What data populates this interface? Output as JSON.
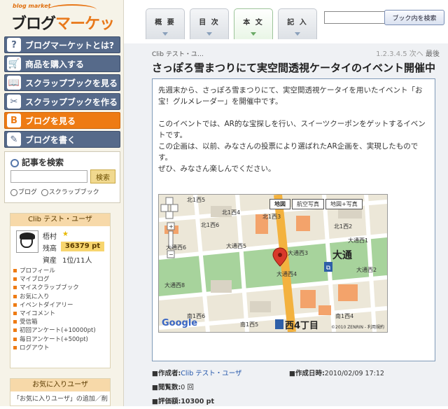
{
  "logo": {
    "tagline": "blog market",
    "name_a": "ブログ",
    "name_b": "マーケット"
  },
  "nav": [
    {
      "label": "ブログマーケットとは?",
      "icon": "question-icon"
    },
    {
      "label": "商品を購入する",
      "icon": "cart-icon"
    },
    {
      "label": "スクラップブックを見る",
      "icon": "book-icon"
    },
    {
      "label": "スクラップブックを作る",
      "icon": "scissors-icon"
    },
    {
      "label": "ブログを見る",
      "icon": "blog-icon"
    },
    {
      "label": "ブログを書く",
      "icon": "pen-icon"
    }
  ],
  "search": {
    "title": "記事を検索",
    "button": "検索",
    "option_blog": "ブログ",
    "option_scrap": "スクラップブック"
  },
  "user": {
    "header": "Clib テスト・ユーザ",
    "name": "梧村",
    "balance_label": "残高",
    "balance": "36379 pt",
    "asset_label": "資産",
    "asset": "1位/11人",
    "links": [
      "プロフィール",
      "マイブログ",
      "マイスクラップブック",
      "お気に入り",
      "イベントダイアリー",
      "マイコメント",
      "受信箱",
      "初回アンケート(+10000pt)",
      "毎日アンケート(+500pt)",
      "ログアウト"
    ]
  },
  "favorites": {
    "header": "お気に入りユーザ",
    "text": "「お気に入りユーザ」の追加／削"
  },
  "tabs": [
    {
      "label": "概 要"
    },
    {
      "label": "目 次"
    },
    {
      "label": "本 文"
    },
    {
      "label": "記 入"
    }
  ],
  "book_search": {
    "placeholder": "",
    "button": "ブック内を検索"
  },
  "article": {
    "breadcrumb": "Clib テスト・ユ…",
    "pager": "1.2.3.4.5 次へ",
    "pager_last": "最後",
    "title": "さっぽろ雪まつりにて実空間透視ケータイのイベント開催中",
    "paragraphs": [
      "先週末から、さっぽろ雪まつりにて、実空間透視ケータイを用いたイベント「お宝！グルメレーダー」を開催中です。",
      "",
      "このイベントでは、AR的な宝探しを行い、スイーツクーポンをゲットするイベントです。",
      "この企画は、以前、みなさんの投票により選ばれたAR企画を、実現したものです。",
      "ぜひ、みなさん楽しんでください。"
    ]
  },
  "map": {
    "btn_map": "地図",
    "btn_aerial": "航空写真",
    "btn_hybrid": "地図+写真",
    "google": "Google",
    "big_label_1": "大通",
    "big_label_2": "西4丁目",
    "copyright": "©2010 ZENRIN - 利用規約",
    "labels": [
      "北1西5",
      "北1西4",
      "北1西3",
      "北1西2",
      "北1西6",
      "大通西6",
      "大通西5",
      "大通西3",
      "大通西1",
      "大通西2",
      "大通西4",
      "大通西8",
      "南1西5",
      "南1西6",
      "南1西4"
    ]
  },
  "meta": {
    "author_label": "■作成者:",
    "author": "Clib テスト・ユーザ",
    "date_label": "■作成日時:",
    "date": "2010/02/09 17:12",
    "views_label": "■閲覧数:",
    "views": "0 回",
    "score_label": "■評価額:",
    "score": "10300 pt"
  }
}
